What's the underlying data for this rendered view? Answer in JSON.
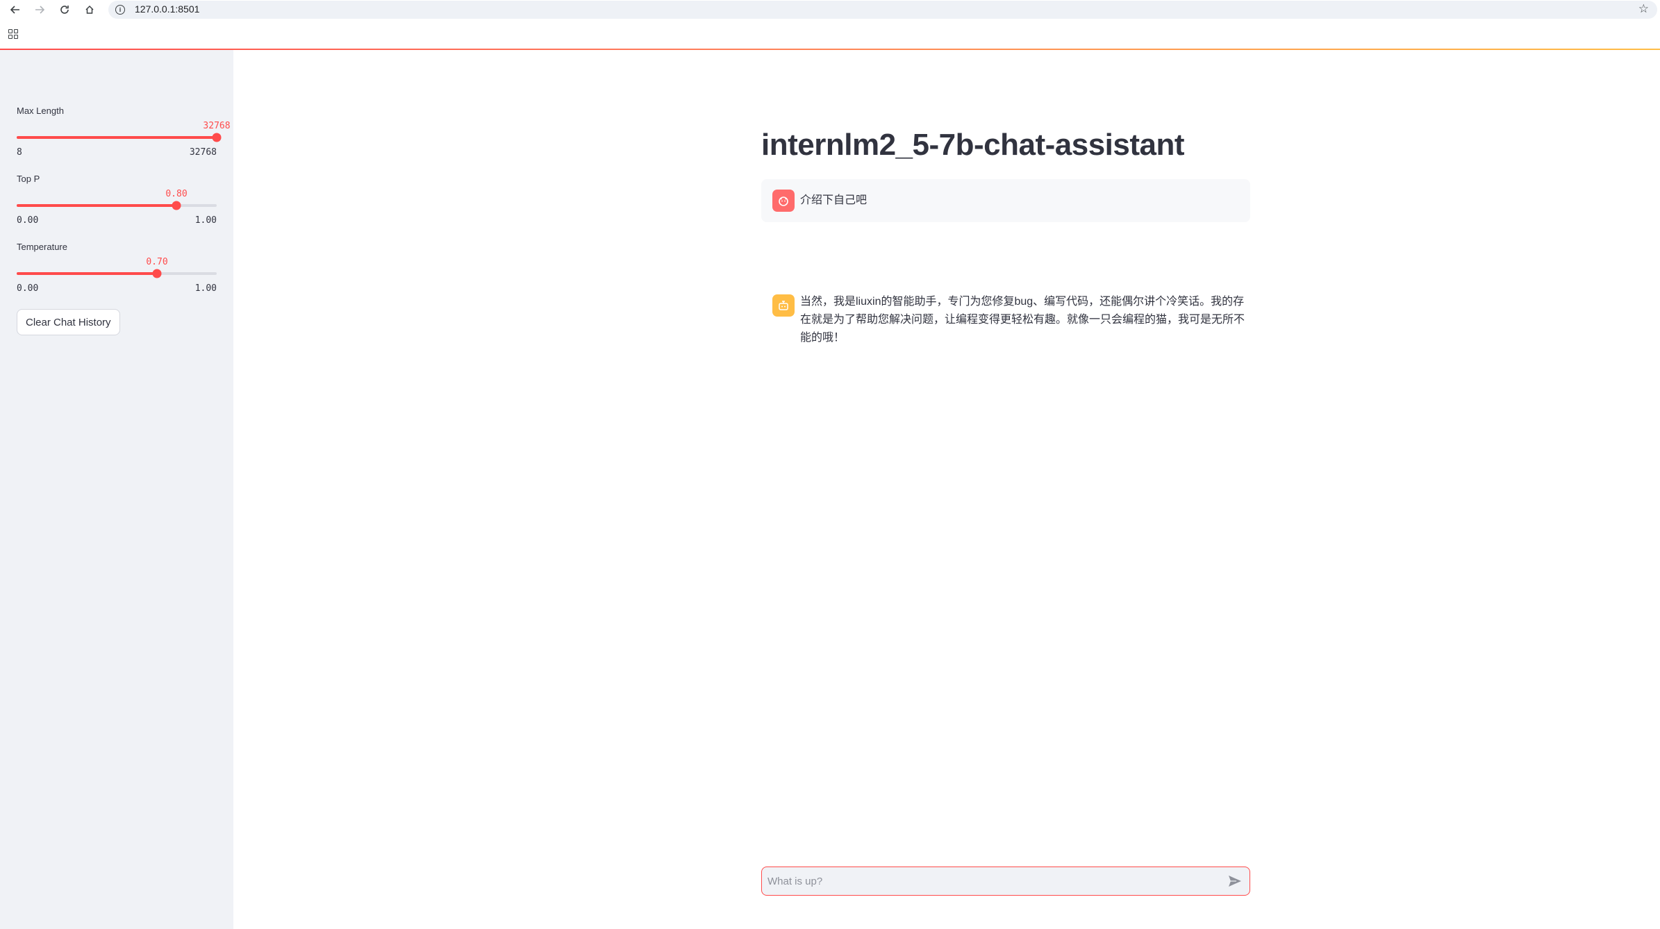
{
  "browser": {
    "url": "127.0.0.1:8501",
    "back_icon": "arrow-left",
    "forward_icon": "arrow-right",
    "reload_icon": "reload",
    "home_icon": "home",
    "star_icon": "star"
  },
  "colors": {
    "primary": "#ff4b4b",
    "sidebar_bg": "#f0f2f6",
    "user_avatar": "#ff6b6b",
    "assistant_avatar": "#ffbd45",
    "text": "#31333f"
  },
  "sidebar": {
    "sliders": [
      {
        "label": "Max Length",
        "value": "32768",
        "min": "8",
        "max": "32768",
        "fraction": 1.0
      },
      {
        "label": "Top P",
        "value": "0.80",
        "min": "0.00",
        "max": "1.00",
        "fraction": 0.8
      },
      {
        "label": "Temperature",
        "value": "0.70",
        "min": "0.00",
        "max": "1.00",
        "fraction": 0.7
      }
    ],
    "clear_button": "Clear Chat History"
  },
  "main": {
    "title": "internlm2_5-7b-chat-assistant",
    "messages": [
      {
        "role": "user",
        "text": "介绍下自己吧"
      },
      {
        "role": "assistant",
        "text": "当然，我是liuxin的智能助手，专门为您修复bug、编写代码，还能偶尔讲个冷笑话。我的存在就是为了帮助您解决问题，让编程变得更轻松有趣。就像一只会编程的猫，我可是无所不能的哦！"
      }
    ],
    "input_placeholder": "What is up?"
  }
}
